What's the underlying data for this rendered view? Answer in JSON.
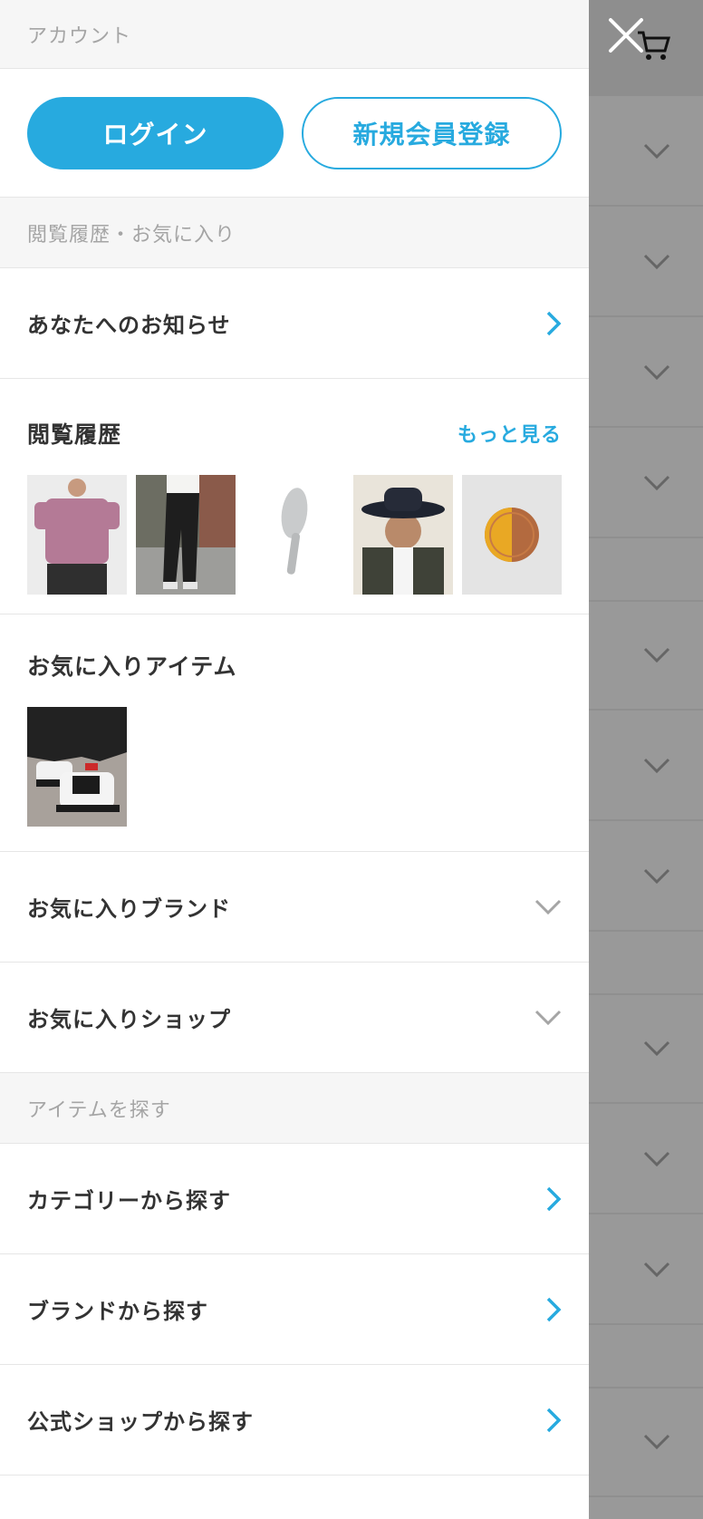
{
  "account": {
    "section_title": "アカウント",
    "login_label": "ログイン",
    "signup_label": "新規会員登録"
  },
  "history_section": {
    "section_title": "閲覧履歴・お気に入り",
    "notifications_label": "あなたへのお知らせ",
    "history_title": "閲覧履歴",
    "more_label": "もっと見る",
    "thumbnails": [
      "pink-tshirt-photo",
      "black-pants-photo",
      "hair-brush-photo",
      "bucket-hat-photo",
      "wooden-plate-photo"
    ],
    "fav_items_title": "お気に入りアイテム",
    "fav_item_thumbnails": [
      "sneakers-photo"
    ],
    "fav_brands_label": "お気に入りブランド",
    "fav_shops_label": "お気に入りショップ"
  },
  "search_section": {
    "section_title": "アイテムを探す",
    "items": [
      {
        "label": "カテゴリーから探す"
      },
      {
        "label": "ブランドから探す"
      },
      {
        "label": "公式ショップから探す"
      }
    ]
  },
  "colors": {
    "accent": "#27aadf",
    "overlay": "#999999"
  }
}
